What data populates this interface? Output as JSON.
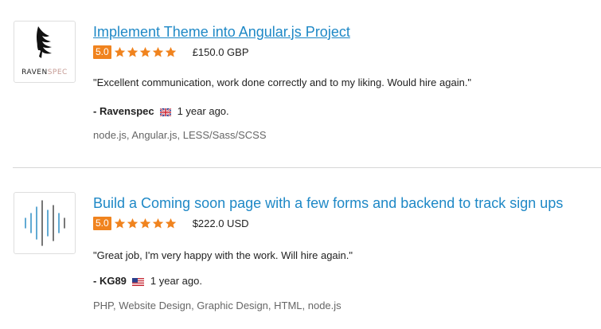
{
  "reviews": [
    {
      "title": "Implement Theme into Angular.js Project",
      "score": "5.0",
      "stars": 5,
      "price": "£150.0 GBP",
      "quote": "\"Excellent communication, work done correctly and to my liking. Would hire again.\"",
      "author": "- Ravenspec",
      "flag_icon": "uk-flag-icon",
      "time": "1 year ago.",
      "tags": "node.js, Angular.js, LESS/Sass/SCSS",
      "logo_icon": "raven-logo-icon",
      "logo_text_a": "RAVEN",
      "logo_text_b": "SPEC"
    },
    {
      "title": "Build a Coming soon page with a few forms and backend to track sign ups",
      "score": "5.0",
      "stars": 5,
      "price": "$222.0 USD",
      "quote": "\"Great job, I'm very happy with the work. Will hire again.\"",
      "author": "- KG89",
      "flag_icon": "us-flag-icon",
      "time": "1 year ago.",
      "tags": "PHP, Website Design, Graphic Design, HTML, node.js",
      "logo_icon": "soundwave-logo-icon"
    }
  ],
  "colors": {
    "link": "#1e88c6",
    "score_badge": "#f0831e",
    "star": "#f0831e"
  }
}
